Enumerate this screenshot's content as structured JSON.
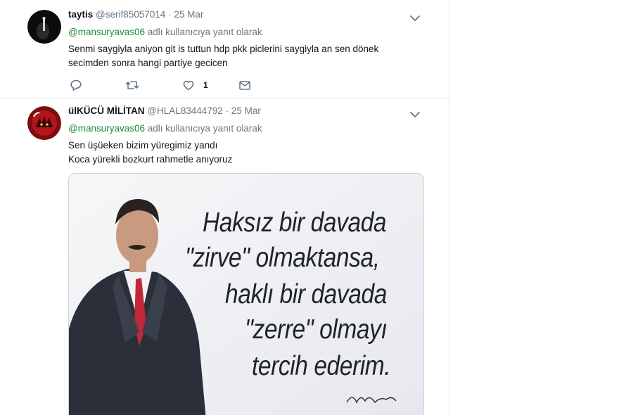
{
  "tweets": [
    {
      "author_name": "taytis",
      "author_handle": "@serif85057014",
      "date": "· 25 Mar",
      "reply_handle": "@mansuryavas06",
      "reply_suffix": " adlı kullanıcıya yanıt olarak",
      "text_lines": [
        "Senmi saygiyla aniyon git is tuttun hdp pkk piclerini saygiyla an sen dönek",
        "secimden sonra hangi partiye gecicen"
      ],
      "actions": {
        "reply_icon": "reply-icon",
        "retweet_icon": "retweet-icon",
        "like_icon": "heart-icon",
        "like_count": "1",
        "dm_icon": "envelope-icon"
      }
    },
    {
      "author_name": "ülKÜCÜ MİLİTAN",
      "author_handle": "@HLAL83444792",
      "date": "· 25 Mar",
      "reply_handle": "@mansuryavas06",
      "reply_suffix": " adlı kullanıcıya yanıt olarak",
      "text_lines": [
        "Sen üşüeken bizim yüregimiz yandı",
        "Koca yürekli bozkurt rahmetle anıyoruz"
      ],
      "media": {
        "quote_lines": [
          "Haksız bir davada",
          "\"zirve\" olmaktansa,",
          "haklı bir davada",
          "\"zerre\" olmayı",
          "tercih ederim."
        ]
      }
    }
  ],
  "colors": {
    "link_green": "#1b8c3b",
    "meta_gray": "#657786",
    "divider": "#e6ecf0"
  }
}
